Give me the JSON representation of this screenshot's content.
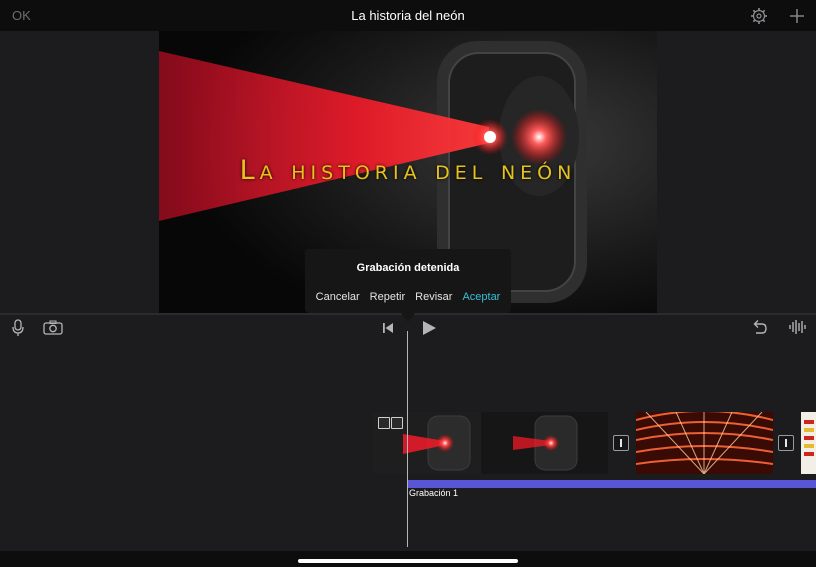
{
  "topbar": {
    "ok_label": "OK",
    "project_title": "La historia del neón",
    "settings_icon": "gear-icon",
    "add_icon": "plus-icon"
  },
  "viewer": {
    "video_title": "La historia del neón"
  },
  "recording_popup": {
    "title": "Grabación detenida",
    "actions": [
      "Cancelar",
      "Repetir",
      "Revisar",
      "Aceptar"
    ],
    "accent_color": "#36bfd9"
  },
  "toolbar": {
    "icons": [
      "microphone-icon",
      "camera-icon",
      "skip-to-start-icon",
      "play-icon",
      "undo-icon",
      "audio-waveform-icon"
    ]
  },
  "timeline": {
    "audio_clip_label": "Grabación 1",
    "audio_clip_color": "#5856d6"
  }
}
